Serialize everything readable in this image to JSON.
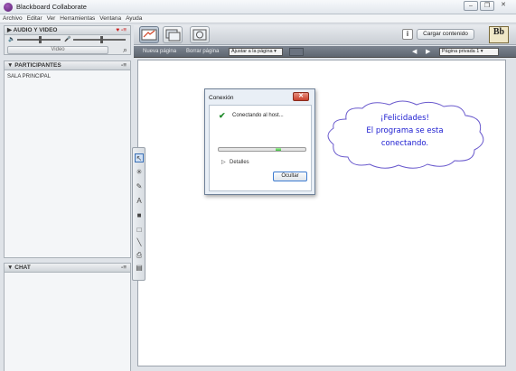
{
  "window": {
    "title": "Blackboard Collaborate",
    "controls": [
      "minimize",
      "restore",
      "close"
    ]
  },
  "menu": [
    "Archivo",
    "Editar",
    "Ver",
    "Herramientas",
    "Ventana",
    "Ayuda"
  ],
  "left_panel": {
    "audio_video": {
      "title": "AUDIO Y VIDEO",
      "video_button": "Video"
    },
    "participants": {
      "title": "PARTICIPANTES",
      "room": "SALA PRINCIPAL"
    },
    "chat": {
      "title": "CHAT"
    }
  },
  "toolbar": {
    "load_content": "Cargar contenido",
    "logo_text": "Bb"
  },
  "page_bar": {
    "new_page": "Nueva página",
    "clear_page": "Borrar página",
    "fit_page": "Ajustar a la página",
    "current_page": "Página privada 1"
  },
  "dialog": {
    "title": "Conexión",
    "status": "Conectando al host...",
    "details": "Detalles",
    "hide_button": "Ocultar",
    "progress": 0.06
  },
  "cloud": {
    "line1": "¡Felicidades!",
    "line2": "El programa se esta",
    "line3": "conectando."
  },
  "colors": {
    "cloud_text": "#1a1ad0",
    "cloud_border": "#6a5acd",
    "check": "#1f8a2a",
    "progress": "#3cbf3c"
  }
}
